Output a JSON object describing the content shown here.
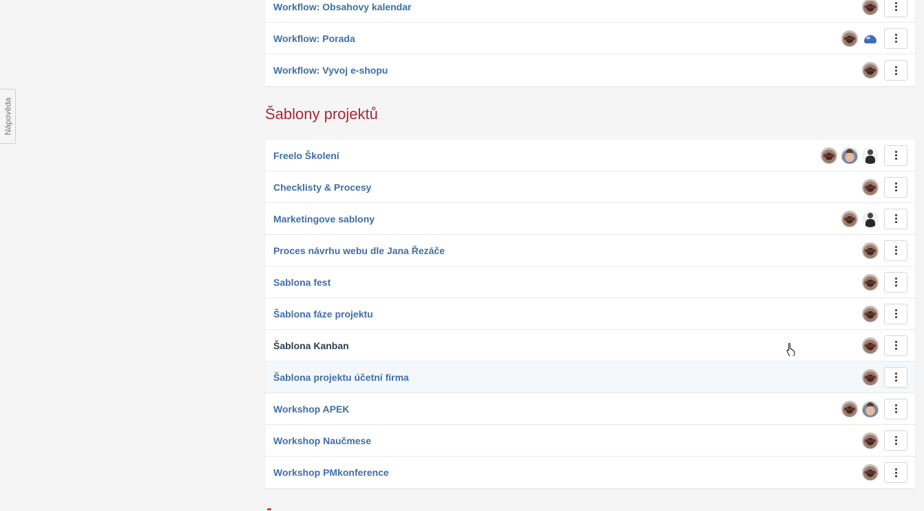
{
  "help_tab": {
    "label": "Nápověda"
  },
  "top_list": [
    {
      "title": "Workflow: Obsahovy kalendar",
      "avatars": [
        "type-a"
      ]
    },
    {
      "title": "Workflow: Porada",
      "avatars": [
        "type-a",
        "type-d"
      ]
    },
    {
      "title": "Workflow: Vyvoj e-shopu",
      "avatars": [
        "type-a"
      ]
    }
  ],
  "templates_section": {
    "title": "Šablony projektů",
    "rows": [
      {
        "title": "Freelo Školení",
        "avatars": [
          "type-a",
          "type-b",
          "type-c"
        ]
      },
      {
        "title": "Checklisty & Procesy",
        "avatars": [
          "type-a"
        ]
      },
      {
        "title": "Marketingove sablony",
        "avatars": [
          "type-a",
          "type-c"
        ]
      },
      {
        "title": "Proces návrhu webu dle Jana Řezáče",
        "avatars": [
          "type-a"
        ]
      },
      {
        "title": "Sablona fest",
        "avatars": [
          "type-a"
        ]
      },
      {
        "title": "Šablona fáze projektu",
        "avatars": [
          "type-a"
        ]
      },
      {
        "title": "Šablona Kanban",
        "avatars": [
          "type-a"
        ],
        "state": "hover"
      },
      {
        "title": "Šablona projektu účetní firma",
        "avatars": [
          "type-a"
        ],
        "state": "highlight"
      },
      {
        "title": "Workshop APEK",
        "avatars": [
          "type-a",
          "type-b"
        ]
      },
      {
        "title": "Workshop Naučmese",
        "avatars": [
          "type-a"
        ]
      },
      {
        "title": "Workshop PMkonference",
        "avatars": [
          "type-a"
        ]
      }
    ]
  },
  "icons": {
    "menu": "kebab-menu-icon",
    "avatar": "user-avatar-icon",
    "cursor": "hand-pointer-icon"
  },
  "colors": {
    "link": "#3e6fa8",
    "section_title": "#a8263b",
    "background": "#f5f5f5"
  }
}
